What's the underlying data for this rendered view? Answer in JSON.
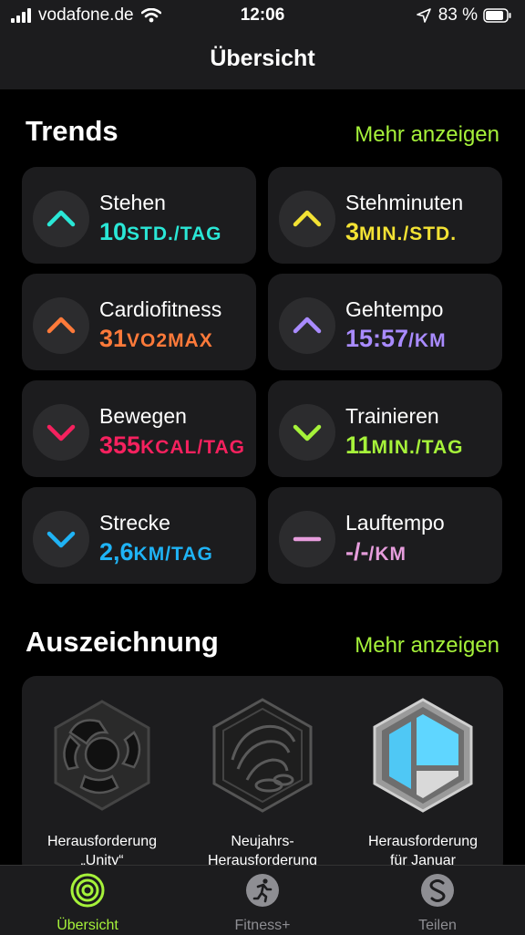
{
  "status": {
    "carrier": "vodafone.de",
    "time": "12:06",
    "battery": "83 %"
  },
  "header": {
    "title": "Übersicht"
  },
  "trends": {
    "title": "Trends",
    "more": "Mehr anzeigen",
    "items": [
      {
        "name": "Stehen",
        "value": "10",
        "unit": "STD./TAG",
        "color": "#2ae7d6",
        "direction": "up"
      },
      {
        "name": "Stehminuten",
        "value": "3",
        "unit": "MIN./STD.",
        "color": "#f3e234",
        "direction": "up"
      },
      {
        "name": "Cardiofitness",
        "value": "31",
        "unit": "VO2MAX",
        "color": "#ff7a3a",
        "direction": "up"
      },
      {
        "name": "Gehtempo",
        "value": "15:57",
        "unit": "/KM",
        "color": "#a98bff",
        "direction": "up"
      },
      {
        "name": "Bewegen",
        "value": "355",
        "unit": "KCAL/TAG",
        "color": "#f5215e",
        "direction": "down"
      },
      {
        "name": "Trainieren",
        "value": "11",
        "unit": "MIN./TAG",
        "color": "#a6f23a",
        "direction": "down"
      },
      {
        "name": "Strecke",
        "value": "2,6",
        "unit": "KM/TAG",
        "color": "#1fb3f5",
        "direction": "down"
      },
      {
        "name": "Lauftempo",
        "value": "-/-",
        "unit": "/KM",
        "color": "#e69ddc",
        "direction": "flat"
      }
    ]
  },
  "awards": {
    "title": "Auszeichnung",
    "more": "Mehr anzeigen",
    "items": [
      {
        "line1": "Herausforderung",
        "line2": "„Unity“"
      },
      {
        "line1": "Neujahrs-",
        "line2": "Herausforderung"
      },
      {
        "line1": "Herausforderung",
        "line2": "für Januar"
      }
    ]
  },
  "tabs": [
    {
      "label": "Übersicht",
      "icon": "activity-rings-icon",
      "active": true
    },
    {
      "label": "Fitness+",
      "icon": "running-figure-icon",
      "active": false
    },
    {
      "label": "Teilen",
      "icon": "share-s-icon",
      "active": false
    }
  ],
  "colors": {
    "accent": "#a6f23a",
    "card": "#1c1c1e",
    "background": "#000000"
  }
}
